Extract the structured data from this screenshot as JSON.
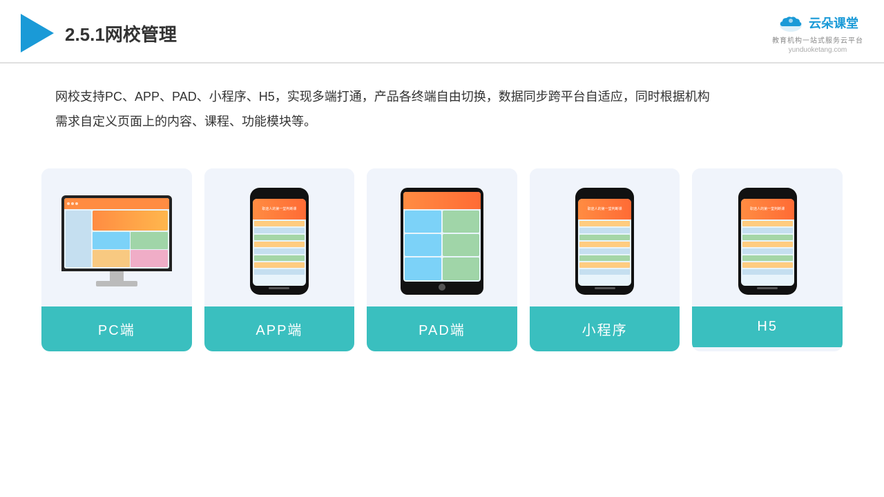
{
  "header": {
    "title": "2.5.1网校管理",
    "brand": {
      "name": "云朵课堂",
      "url": "yunduoketang.com",
      "tagline": "教育机构一站式服务云平台"
    }
  },
  "description": {
    "line1": "网校支持PC、APP、PAD、小程序、H5，实现多端打通，产品各终端自由切换，数据同步跨平台自适应，同时根据机构",
    "line2": "需求自定义页面上的内容、课程、功能模块等。"
  },
  "cards": [
    {
      "id": "pc",
      "label": "PC端",
      "type": "pc"
    },
    {
      "id": "app",
      "label": "APP端",
      "type": "phone"
    },
    {
      "id": "pad",
      "label": "PAD端",
      "type": "pad"
    },
    {
      "id": "miniprogram",
      "label": "小程序",
      "type": "phone"
    },
    {
      "id": "h5",
      "label": "H5",
      "type": "phone"
    }
  ]
}
